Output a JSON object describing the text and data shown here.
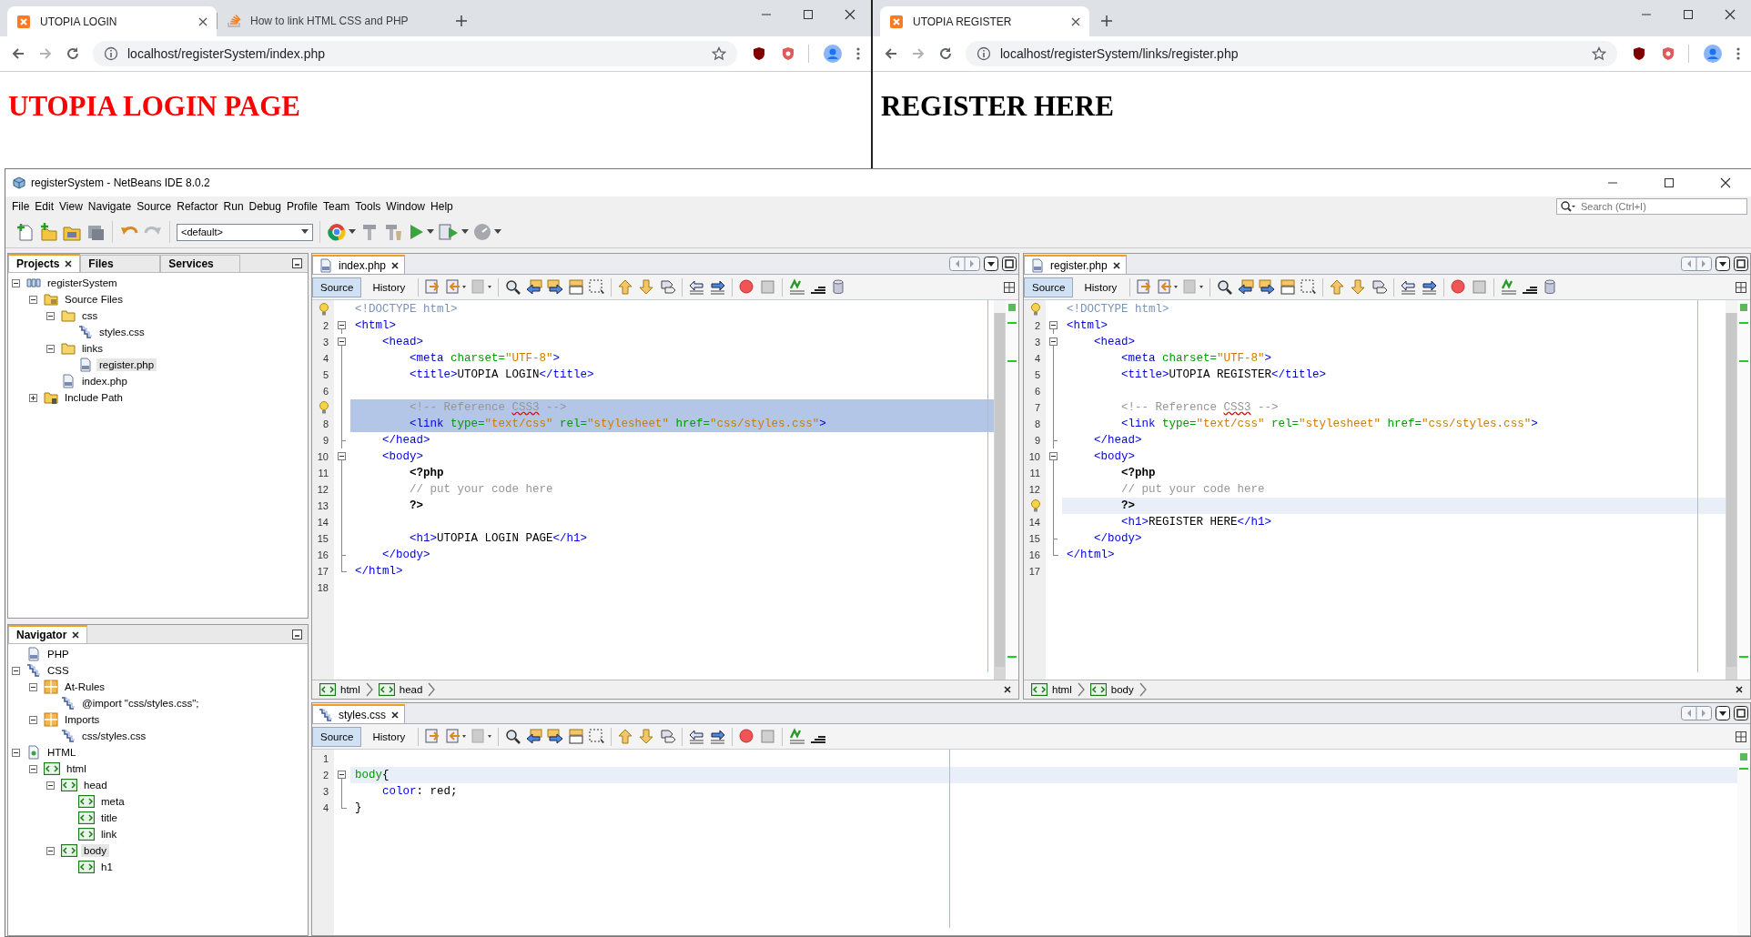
{
  "browsers": [
    {
      "tabs": [
        {
          "title": "UTOPIA LOGIN",
          "kind": "xampp",
          "selected": true
        },
        {
          "title": "How to link HTML CSS and PHP",
          "kind": "stack",
          "selected": false
        }
      ],
      "url": "localhost/registerSystem/index.php",
      "heading": {
        "text": "UTOPIA LOGIN PAGE",
        "color": "#ff0000"
      }
    },
    {
      "tabs": [
        {
          "title": "UTOPIA REGISTER",
          "kind": "xampp",
          "selected": true
        }
      ],
      "url": "localhost/registerSystem/links/register.php",
      "heading": {
        "text": "REGISTER HERE",
        "color": "#000000"
      }
    }
  ],
  "ide": {
    "title": "registerSystem - NetBeans IDE 8.0.2",
    "menu": [
      "File",
      "Edit",
      "View",
      "Navigate",
      "Source",
      "Refactor",
      "Run",
      "Debug",
      "Profile",
      "Team",
      "Tools",
      "Window",
      "Help"
    ],
    "search": {
      "placeholder": "Search (Ctrl+I)"
    },
    "configuration": "<default>",
    "panels": [
      {
        "tabs": [
          {
            "label": "Projects",
            "selected": true,
            "closable": true
          },
          {
            "label": "Files",
            "selected": false,
            "closable": false
          },
          {
            "label": "Services",
            "selected": false,
            "closable": false
          }
        ],
        "tree": [
          {
            "label": "registerSystem",
            "kind": "project",
            "expanded": true,
            "selected": false,
            "children": [
              {
                "label": "Source Files",
                "kind": "source-folder",
                "expanded": true,
                "selected": false,
                "children": [
                  {
                    "label": "css",
                    "kind": "folder",
                    "expanded": true,
                    "selected": false,
                    "children": [
                      {
                        "label": "styles.css",
                        "kind": "css",
                        "expanded": false,
                        "selected": false
                      }
                    ]
                  },
                  {
                    "label": "links",
                    "kind": "folder",
                    "expanded": true,
                    "selected": false,
                    "children": [
                      {
                        "label": "register.php",
                        "kind": "php",
                        "expanded": false,
                        "selected": true
                      }
                    ]
                  },
                  {
                    "label": "index.php",
                    "kind": "php",
                    "expanded": false,
                    "selected": false
                  }
                ]
              },
              {
                "label": "Include Path",
                "kind": "include",
                "expanded": false,
                "selected": false
              }
            ]
          }
        ]
      },
      {
        "tabs": [
          {
            "label": "Navigator",
            "selected": true,
            "closable": true
          }
        ],
        "tree": [
          {
            "label": "PHP",
            "kind": "php",
            "expanded": false,
            "selected": false
          },
          {
            "label": "CSS",
            "kind": "css",
            "expanded": true,
            "selected": false,
            "children": [
              {
                "label": "At-Rules",
                "kind": "category",
                "expanded": true,
                "selected": false,
                "children": [
                  {
                    "label": "@import \"css/styles.css\";",
                    "kind": "css",
                    "expanded": false,
                    "selected": false
                  }
                ]
              },
              {
                "label": "Imports",
                "kind": "category",
                "expanded": true,
                "selected": false,
                "children": [
                  {
                    "label": "css/styles.css",
                    "kind": "css",
                    "expanded": false,
                    "selected": false
                  }
                ]
              }
            ]
          },
          {
            "label": "HTML",
            "kind": "html",
            "expanded": true,
            "selected": false,
            "children": [
              {
                "label": "html",
                "kind": "tag",
                "expanded": true,
                "selected": false,
                "children": [
                  {
                    "label": "head",
                    "kind": "tag",
                    "expanded": true,
                    "selected": false,
                    "children": [
                      {
                        "label": "meta",
                        "kind": "tag",
                        "expanded": false,
                        "selected": false
                      },
                      {
                        "label": "title",
                        "kind": "tag",
                        "expanded": false,
                        "selected": false
                      },
                      {
                        "label": "link",
                        "kind": "tag",
                        "expanded": false,
                        "selected": false
                      }
                    ]
                  },
                  {
                    "label": "body",
                    "kind": "tag",
                    "expanded": true,
                    "selected": true,
                    "children": [
                      {
                        "label": "h1",
                        "kind": "tag",
                        "expanded": false,
                        "selected": false
                      }
                    ]
                  }
                ]
              }
            ]
          }
        ]
      }
    ],
    "editors": [
      {
        "tab": {
          "label": "index.php",
          "kind": "php",
          "selected": true
        },
        "views": [
          {
            "label": "Source",
            "selected": true
          },
          {
            "label": "History",
            "selected": false
          }
        ],
        "lines": [
          {
            "hint": true,
            "kind": "plain",
            "selected": false,
            "current": false,
            "tokens": [
              {
                "kind": "doctype",
                "text": "<!DOCTYPE html>"
              }
            ]
          },
          {
            "number": "2",
            "hint": false,
            "kind": "start",
            "selected": false,
            "current": false,
            "tokens": [
              {
                "kind": "tag",
                "text": "<html>"
              }
            ]
          },
          {
            "number": "3",
            "hint": false,
            "kind": "start",
            "selected": false,
            "current": false,
            "tokens": [
              {
                "kind": "tag",
                "text": "    <head>"
              }
            ]
          },
          {
            "number": "4",
            "hint": false,
            "kind": "line",
            "selected": false,
            "current": false,
            "tokens": [
              {
                "kind": "tag",
                "text": "        <meta "
              },
              {
                "kind": "attr",
                "text": "charset="
              },
              {
                "kind": "value",
                "text": "\"UTF-8\""
              },
              {
                "kind": "tag",
                "text": ">"
              }
            ]
          },
          {
            "number": "5",
            "hint": false,
            "kind": "line",
            "selected": false,
            "current": false,
            "tokens": [
              {
                "kind": "tag",
                "text": "        <title>"
              },
              {
                "kind": "text",
                "text": "UTOPIA LOGIN"
              },
              {
                "kind": "tag",
                "text": "</title>"
              }
            ]
          },
          {
            "number": "6",
            "hint": false,
            "kind": "line",
            "selected": false,
            "current": false
          },
          {
            "hint": true,
            "kind": "line",
            "selected": true,
            "current": false,
            "tokens": [
              {
                "kind": "comment",
                "text": "        <!-- Reference "
              },
              {
                "kind": "comment_error",
                "text": "CSS3"
              },
              {
                "kind": "comment",
                "text": " -->"
              }
            ]
          },
          {
            "number": "8",
            "hint": false,
            "kind": "line",
            "selected": true,
            "current": false,
            "tokens": [
              {
                "kind": "tag",
                "text": "        <link "
              },
              {
                "kind": "attr",
                "text": "type="
              },
              {
                "kind": "value",
                "text": "\"text/css\""
              },
              {
                "kind": "attr",
                "text": " rel="
              },
              {
                "kind": "value",
                "text": "\"stylesheet\""
              },
              {
                "kind": "attr",
                "text": " href="
              },
              {
                "kind": "value",
                "text": "\"css/styles.css\""
              },
              {
                "kind": "tag",
                "text": ">"
              }
            ]
          },
          {
            "number": "9",
            "hint": false,
            "kind": "end",
            "selected": false,
            "current": false,
            "tokens": [
              {
                "kind": "tag",
                "text": "    </head>"
              }
            ]
          },
          {
            "number": "10",
            "hint": false,
            "kind": "start",
            "selected": false,
            "current": false,
            "tokens": [
              {
                "kind": "tag",
                "text": "    <body>"
              }
            ]
          },
          {
            "number": "11",
            "hint": false,
            "kind": "line",
            "selected": false,
            "current": false,
            "tokens": [
              {
                "kind": "php",
                "text": "        <?php"
              }
            ]
          },
          {
            "number": "12",
            "hint": false,
            "kind": "line",
            "selected": false,
            "current": false,
            "tokens": [
              {
                "kind": "comment",
                "text": "        // put your code here"
              }
            ]
          },
          {
            "number": "13",
            "hint": false,
            "kind": "line",
            "selected": false,
            "current": false,
            "tokens": [
              {
                "kind": "php",
                "text": "        ?>"
              }
            ]
          },
          {
            "number": "14",
            "hint": false,
            "kind": "line",
            "selected": false,
            "current": false
          },
          {
            "number": "15",
            "hint": false,
            "kind": "line",
            "selected": false,
            "current": false,
            "tokens": [
              {
                "kind": "tag",
                "text": "        <h1>"
              },
              {
                "kind": "text",
                "text": "UTOPIA LOGIN PAGE"
              },
              {
                "kind": "tag",
                "text": "</h1>"
              }
            ]
          },
          {
            "number": "16",
            "hint": false,
            "kind": "end",
            "selected": false,
            "current": false,
            "tokens": [
              {
                "kind": "tag",
                "text": "    </body>"
              }
            ]
          },
          {
            "number": "17",
            "hint": false,
            "kind": "last",
            "selected": false,
            "current": false,
            "tokens": [
              {
                "kind": "tag",
                "text": "</html>"
              }
            ]
          },
          {
            "number": "18",
            "hint": false,
            "kind": "plain",
            "selected": false,
            "current": false
          }
        ],
        "breadcrumbs": [
          {
            "label": "html"
          },
          {
            "label": "head"
          }
        ]
      },
      {
        "tab": {
          "label": "register.php",
          "kind": "php",
          "selected": true
        },
        "views": [
          {
            "label": "Source",
            "selected": true
          },
          {
            "label": "History",
            "selected": false
          }
        ],
        "lines": [
          {
            "hint": true,
            "kind": "plain",
            "selected": false,
            "current": false,
            "tokens": [
              {
                "kind": "doctype",
                "text": "<!DOCTYPE html>"
              }
            ]
          },
          {
            "number": "2",
            "hint": false,
            "kind": "start",
            "selected": false,
            "current": false,
            "tokens": [
              {
                "kind": "tag",
                "text": "<html>"
              }
            ]
          },
          {
            "number": "3",
            "hint": false,
            "kind": "start",
            "selected": false,
            "current": false,
            "tokens": [
              {
                "kind": "tag",
                "text": "    <head>"
              }
            ]
          },
          {
            "number": "4",
            "hint": false,
            "kind": "line",
            "selected": false,
            "current": false,
            "tokens": [
              {
                "kind": "tag",
                "text": "        <meta "
              },
              {
                "kind": "attr",
                "text": "charset="
              },
              {
                "kind": "value",
                "text": "\"UTF-8\""
              },
              {
                "kind": "tag",
                "text": ">"
              }
            ]
          },
          {
            "number": "5",
            "hint": false,
            "kind": "line",
            "selected": false,
            "current": false,
            "tokens": [
              {
                "kind": "tag",
                "text": "        <title>"
              },
              {
                "kind": "text",
                "text": "UTOPIA REGISTER"
              },
              {
                "kind": "tag",
                "text": "</title>"
              }
            ]
          },
          {
            "number": "6",
            "hint": false,
            "kind": "line",
            "selected": false,
            "current": false
          },
          {
            "number": "7",
            "hint": false,
            "kind": "line",
            "selected": false,
            "current": false,
            "tokens": [
              {
                "kind": "comment",
                "text": "        <!-- Reference "
              },
              {
                "kind": "comment_error",
                "text": "CSS3"
              },
              {
                "kind": "comment",
                "text": " -->"
              }
            ]
          },
          {
            "number": "8",
            "hint": false,
            "kind": "line",
            "selected": false,
            "current": false,
            "tokens": [
              {
                "kind": "tag",
                "text": "        <link "
              },
              {
                "kind": "attr",
                "text": "type="
              },
              {
                "kind": "value",
                "text": "\"text/css\""
              },
              {
                "kind": "attr",
                "text": " rel="
              },
              {
                "kind": "value",
                "text": "\"stylesheet\""
              },
              {
                "kind": "attr",
                "text": " href="
              },
              {
                "kind": "value",
                "text": "\"css/styles.css\""
              },
              {
                "kind": "tag",
                "text": ">"
              }
            ]
          },
          {
            "number": "9",
            "hint": false,
            "kind": "end",
            "selected": false,
            "current": false,
            "tokens": [
              {
                "kind": "tag",
                "text": "    </head>"
              }
            ]
          },
          {
            "number": "10",
            "hint": false,
            "kind": "start",
            "selected": false,
            "current": false,
            "tokens": [
              {
                "kind": "tag",
                "text": "    <body>"
              }
            ]
          },
          {
            "number": "11",
            "hint": false,
            "kind": "line",
            "selected": false,
            "current": false,
            "tokens": [
              {
                "kind": "php",
                "text": "        <?php"
              }
            ]
          },
          {
            "number": "12",
            "hint": false,
            "kind": "line",
            "selected": false,
            "current": false,
            "tokens": [
              {
                "kind": "comment",
                "text": "        // put your code here"
              }
            ]
          },
          {
            "hint": true,
            "kind": "line",
            "selected": false,
            "current": true,
            "tokens": [
              {
                "kind": "php",
                "text": "        ?>"
              }
            ]
          },
          {
            "number": "14",
            "hint": false,
            "kind": "line",
            "selected": false,
            "current": false,
            "tokens": [
              {
                "kind": "tag",
                "text": "        <h1>"
              },
              {
                "kind": "text",
                "text": "REGISTER HERE"
              },
              {
                "kind": "tag",
                "text": "</h1>"
              }
            ]
          },
          {
            "number": "15",
            "hint": false,
            "kind": "end",
            "selected": false,
            "current": false,
            "tokens": [
              {
                "kind": "tag",
                "text": "    </body>"
              }
            ]
          },
          {
            "number": "16",
            "hint": false,
            "kind": "last",
            "selected": false,
            "current": false,
            "tokens": [
              {
                "kind": "tag",
                "text": "</html>"
              }
            ]
          },
          {
            "number": "17",
            "hint": false,
            "kind": "plain",
            "selected": false,
            "current": false
          }
        ],
        "breadcrumbs": [
          {
            "label": "html"
          },
          {
            "label": "body"
          }
        ]
      },
      {
        "tab": {
          "label": "styles.css",
          "kind": "css",
          "selected": true
        },
        "views": [
          {
            "label": "Source",
            "selected": true
          },
          {
            "label": "History",
            "selected": false
          }
        ],
        "lines": [
          {
            "number": "1",
            "hint": false,
            "kind": "plain",
            "selected": false,
            "current": false
          },
          {
            "number": "2",
            "hint": false,
            "kind": "start",
            "selected": false,
            "current": true,
            "tokens": [
              {
                "kind": "selector",
                "text": "body"
              },
              {
                "kind": "text",
                "text": "{"
              }
            ]
          },
          {
            "number": "3",
            "hint": false,
            "kind": "line",
            "selected": false,
            "current": false,
            "tokens": [
              {
                "kind": "property",
                "text": "    color"
              },
              {
                "kind": "text",
                "text": ": red;"
              }
            ]
          },
          {
            "number": "4",
            "hint": false,
            "kind": "last",
            "selected": false,
            "current": false,
            "tokens": [
              {
                "kind": "text",
                "text": "}"
              }
            ]
          }
        ]
      }
    ]
  }
}
